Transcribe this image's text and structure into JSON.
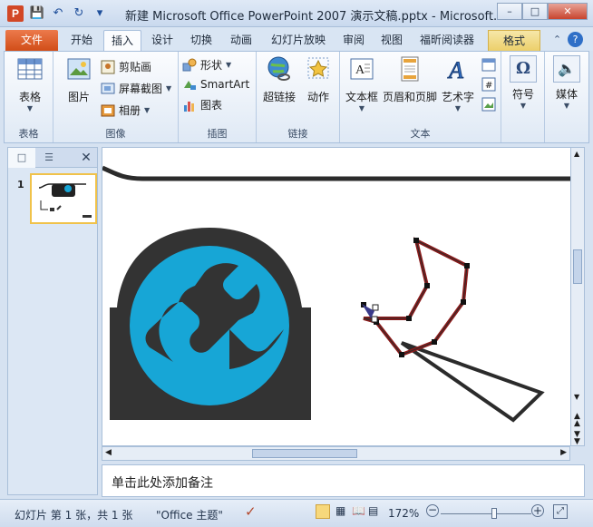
{
  "window": {
    "title": "新建 Microsoft Office PowerPoint 2007 演示文稿.pptx - Microsoft...",
    "app_icon_letter": "P"
  },
  "tabs": [
    {
      "label": "文件"
    },
    {
      "label": "开始"
    },
    {
      "label": "插入"
    },
    {
      "label": "设计"
    },
    {
      "label": "切换"
    },
    {
      "label": "动画"
    },
    {
      "label": "幻灯片放映"
    },
    {
      "label": "审阅"
    },
    {
      "label": "视图"
    },
    {
      "label": "福昕阅读器"
    },
    {
      "label": "格式"
    }
  ],
  "ribbon": {
    "groups": {
      "table": {
        "label": "表格",
        "button": "表格"
      },
      "image": {
        "label": "图像",
        "picture": "图片",
        "clip": "剪贴画",
        "screenshot": "屏幕截图",
        "album": "相册"
      },
      "illustration": {
        "label": "插图",
        "shapes": "形状",
        "smartart": "SmartArt",
        "chart": "图表"
      },
      "links": {
        "label": "链接",
        "hyperlink": "超链接",
        "action": "动作"
      },
      "text": {
        "label": "文本",
        "textbox": "文本框",
        "header": "页眉和页脚",
        "wordart": "艺术字"
      },
      "symbols": {
        "label": "符号"
      },
      "media": {
        "label": "媒体"
      }
    }
  },
  "slides_pane": {
    "slide_number": "1"
  },
  "notes": {
    "placeholder": "单击此处添加备注"
  },
  "status": {
    "slide_info": "幻灯片 第 1 张，共 1 张",
    "theme": "\"Office 主题\"",
    "zoom": "172%"
  },
  "colors": {
    "accent_file_tab": "#d14d18",
    "logo_dark": "#333333",
    "logo_blue": "#17a6d6",
    "shape_outline": "#8b1a1a"
  }
}
